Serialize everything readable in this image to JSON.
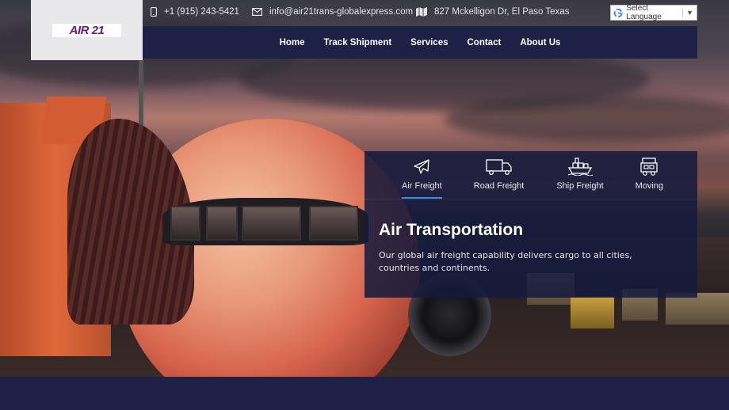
{
  "brand": {
    "logo_text": "AIR 21"
  },
  "contact": {
    "phone": "+1 (915) 243-5421",
    "email": "info@air21trans-globalexpress.com",
    "address": "827 Mckelligon Dr, El Paso Texas"
  },
  "language": {
    "label": "Select Language",
    "arrow": "▼"
  },
  "nav": {
    "items": [
      {
        "label": "Home"
      },
      {
        "label": "Track Shipment"
      },
      {
        "label": "Services"
      },
      {
        "label": "Contact"
      },
      {
        "label": "About Us"
      }
    ]
  },
  "panel": {
    "tabs": [
      {
        "label": "Air Freight",
        "icon": "plane-icon",
        "active": true
      },
      {
        "label": "Road Freight",
        "icon": "truck-icon",
        "active": false
      },
      {
        "label": "Ship Freight",
        "icon": "ship-icon",
        "active": false
      },
      {
        "label": "Moving",
        "icon": "moving-truck-icon",
        "active": false
      }
    ],
    "title": "Air Transportation",
    "description": "Our global air freight capability delivers cargo to all cities, countries and continents."
  },
  "colors": {
    "navbar": "#1c2145",
    "panel": "#141a3c",
    "accent": "#3b8de0",
    "logo": "#6a1a8a"
  }
}
